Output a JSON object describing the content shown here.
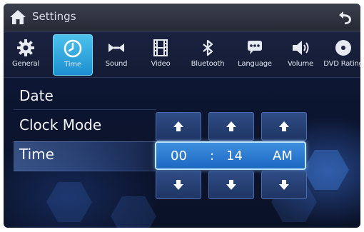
{
  "header": {
    "title": "Settings"
  },
  "tabs": [
    {
      "label": "General",
      "icon": "gear-icon"
    },
    {
      "label": "Time",
      "icon": "clock-icon",
      "active": true
    },
    {
      "label": "Sound",
      "icon": "speaker-eq-icon"
    },
    {
      "label": "Video",
      "icon": "film-icon"
    },
    {
      "label": "Bluetooth",
      "icon": "bluetooth-icon"
    },
    {
      "label": "Language",
      "icon": "speech-bubble-icon"
    },
    {
      "label": "Volume",
      "icon": "volume-icon"
    },
    {
      "label": "DVD Rating",
      "icon": "disc-icon"
    }
  ],
  "menu": {
    "date": "Date",
    "clock_mode": "Clock Mode",
    "time": "Time"
  },
  "time_value": {
    "hour": "00",
    "separator": ":",
    "minute": "14",
    "period": "AM"
  },
  "colors": {
    "accent": "#2f9fe0",
    "active_tab": "#3fb6ea",
    "background": "#0c1530"
  }
}
